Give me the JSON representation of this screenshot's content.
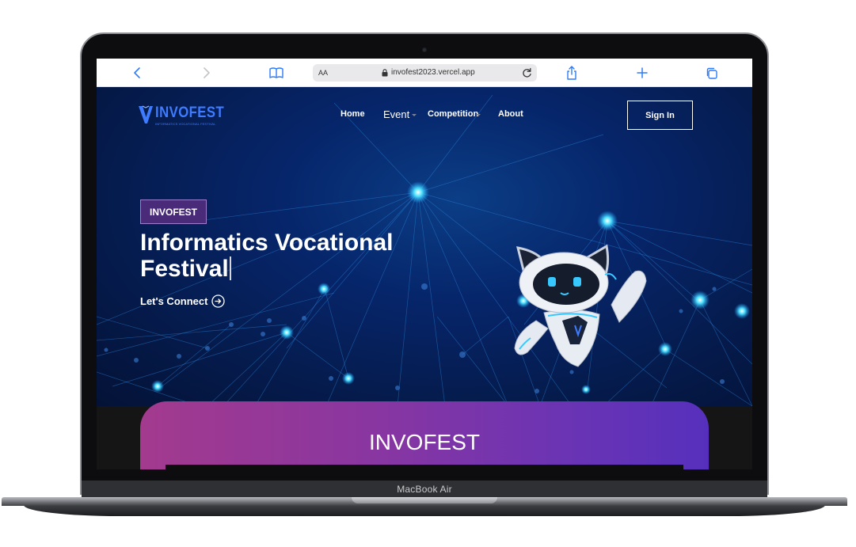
{
  "device": {
    "model_label": "MacBook Air"
  },
  "browser": {
    "address_text_size": "AA",
    "url": "invofest2023.vercel.app",
    "icons": {
      "back": "chevron-left-icon",
      "forward": "chevron-right-icon",
      "bookmarks": "book-icon",
      "lock": "lock-icon",
      "reload": "reload-icon",
      "share": "share-icon",
      "new_tab": "plus-icon",
      "tabs": "tabs-icon"
    },
    "accent_color": "#2f7cf6"
  },
  "site": {
    "logo": {
      "text": "INVOFEST",
      "subtitle": "INFORMATICS VOCATIONAL FESTIVAL"
    },
    "nav": {
      "home": "Home",
      "event": "Event",
      "competition": "Competition",
      "about": "About",
      "sign_in": "Sign In"
    },
    "hero": {
      "badge": "INVOFEST",
      "title_line1": "Informatics Vocational",
      "title_line2": "Festival",
      "cta": "Let's Connect",
      "cta_icon": "arrow-right-circle-icon",
      "mascot": "robot-cat-mascot"
    },
    "section": {
      "title": "INVOFEST"
    },
    "colors": {
      "hero_bg": "#06256a",
      "badge_bg": "#4a2b7a",
      "gradient_start": "#a33a8e",
      "gradient_end": "#5630bc",
      "glow": "#2fd3ff"
    }
  }
}
